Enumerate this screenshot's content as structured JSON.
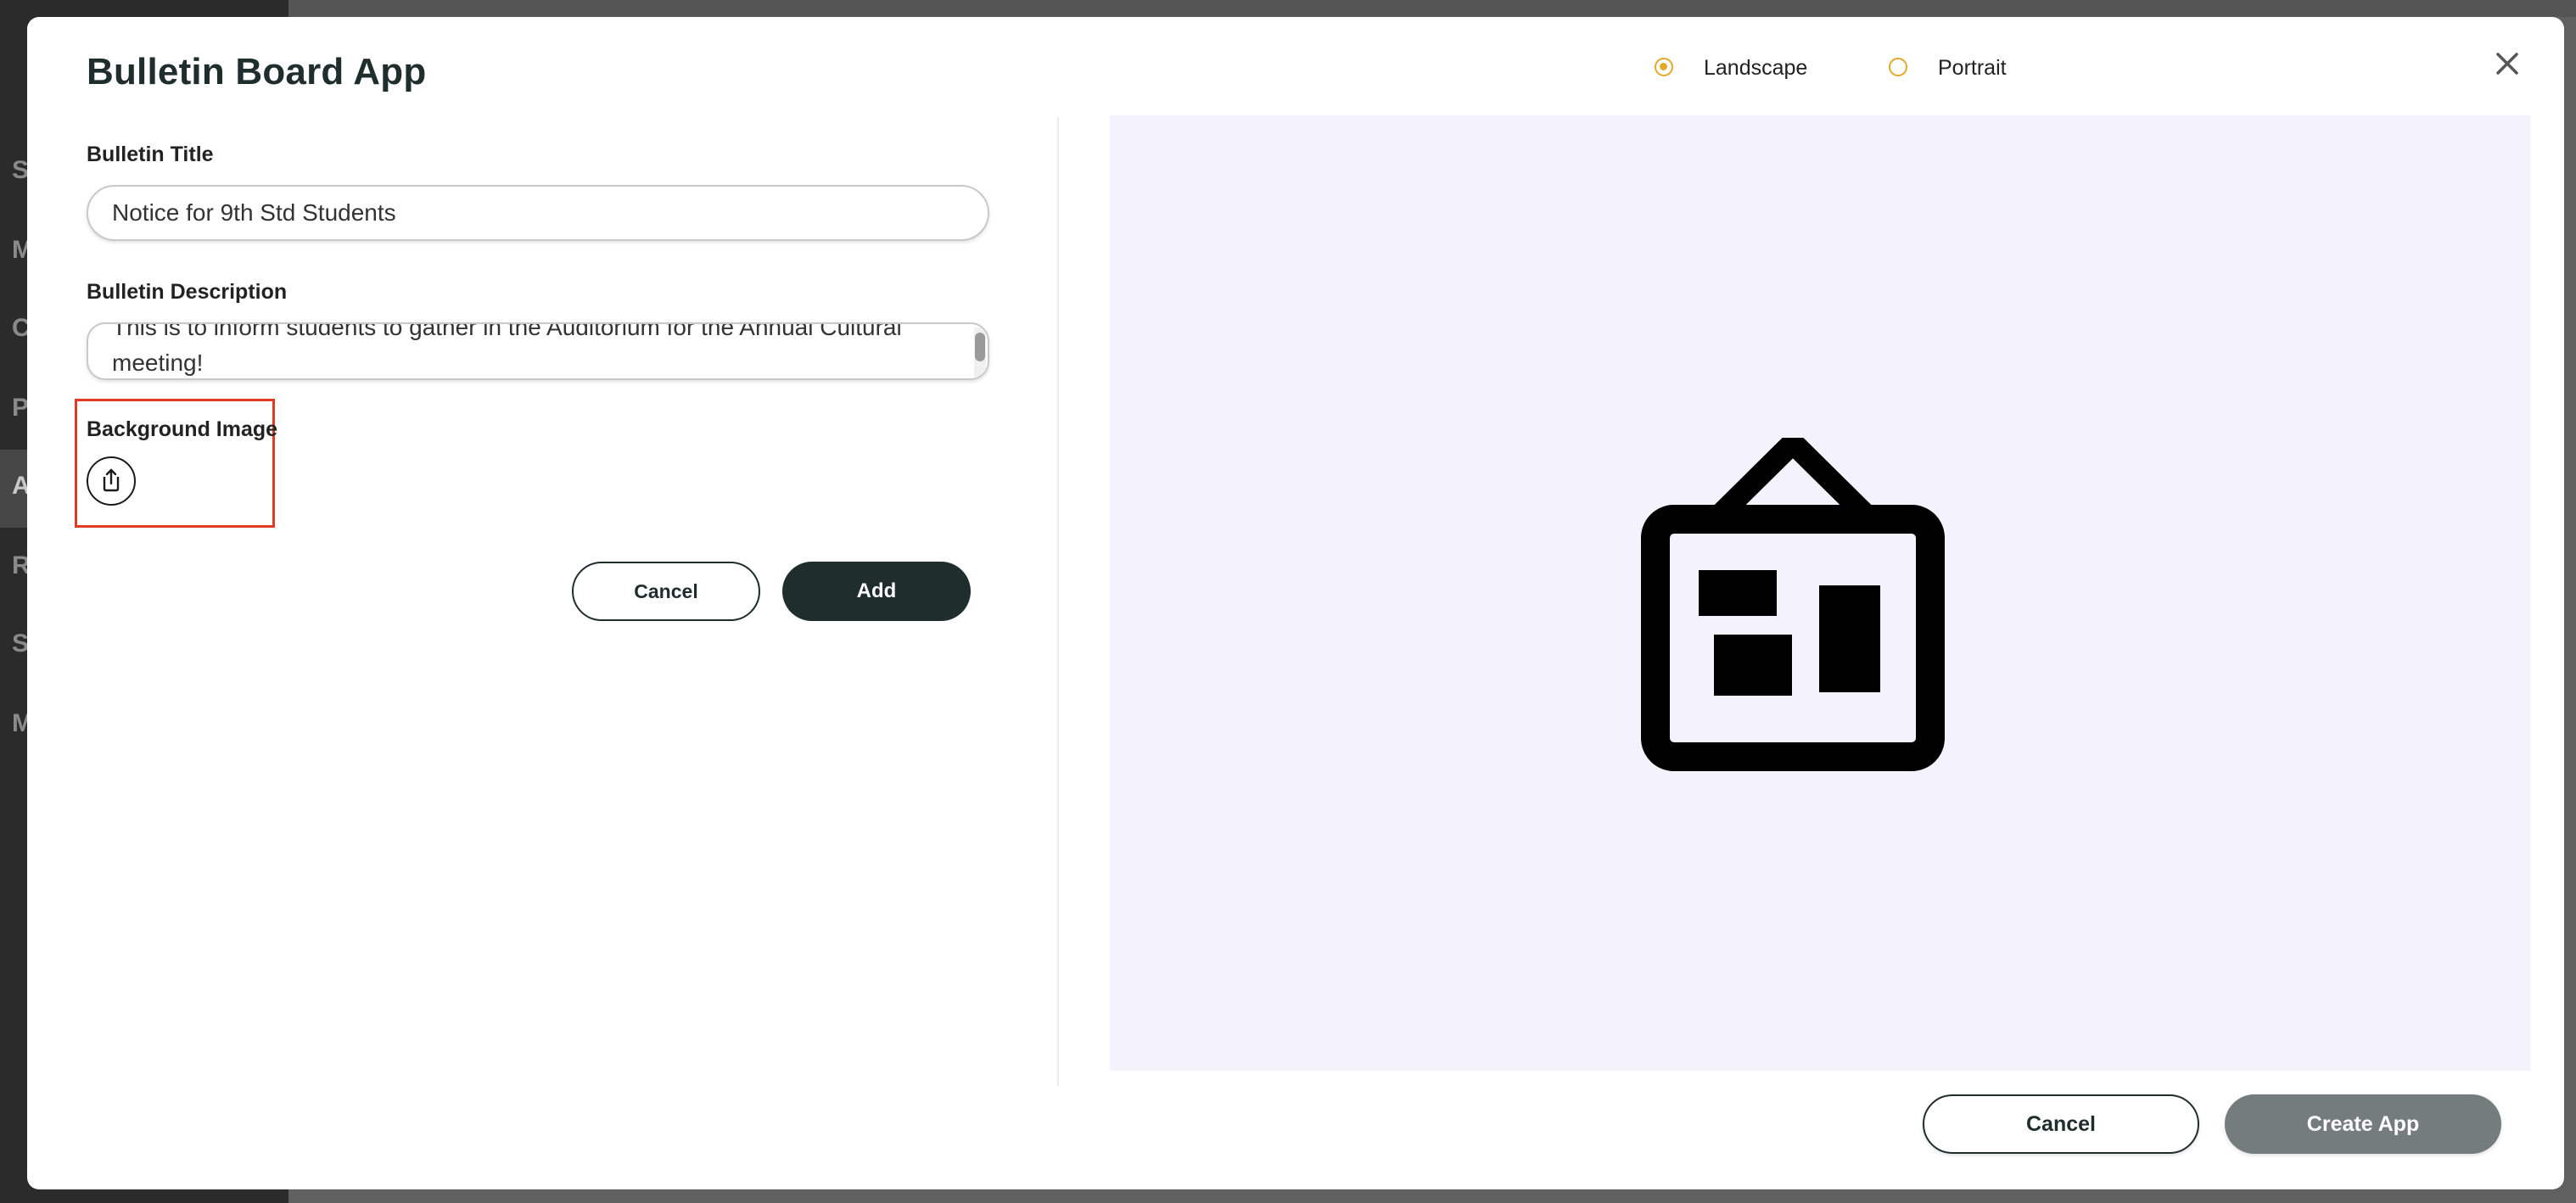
{
  "background": {
    "sidebar_letters": [
      "S",
      "M",
      "C",
      "P",
      "A",
      "R",
      "S",
      "M"
    ]
  },
  "modal": {
    "title": "Bulletin Board App",
    "close_icon": "close-icon",
    "orientation": {
      "options": [
        {
          "label": "Landscape",
          "checked": true
        },
        {
          "label": "Portrait",
          "checked": false
        }
      ],
      "accent_color": "#e3a928"
    },
    "form": {
      "title_label": "Bulletin Title",
      "title_value": "Notice for 9th Std Students",
      "description_label": "Bulletin Description",
      "description_value": "This is to inform students to gather in the Auditorium for the Annual Cultural meeting!",
      "background_image_label": "Background Image",
      "upload_icon": "upload-icon",
      "cancel_label": "Cancel",
      "add_label": "Add"
    },
    "preview": {
      "background_color": "#f4f2fc",
      "icon": "bulletin-board-icon"
    },
    "footer": {
      "cancel_label": "Cancel",
      "create_label": "Create App"
    }
  },
  "colors": {
    "primary_dark": "#1f2d2d",
    "highlight_box": "#e03b24",
    "disabled_button": "#747c7c"
  }
}
